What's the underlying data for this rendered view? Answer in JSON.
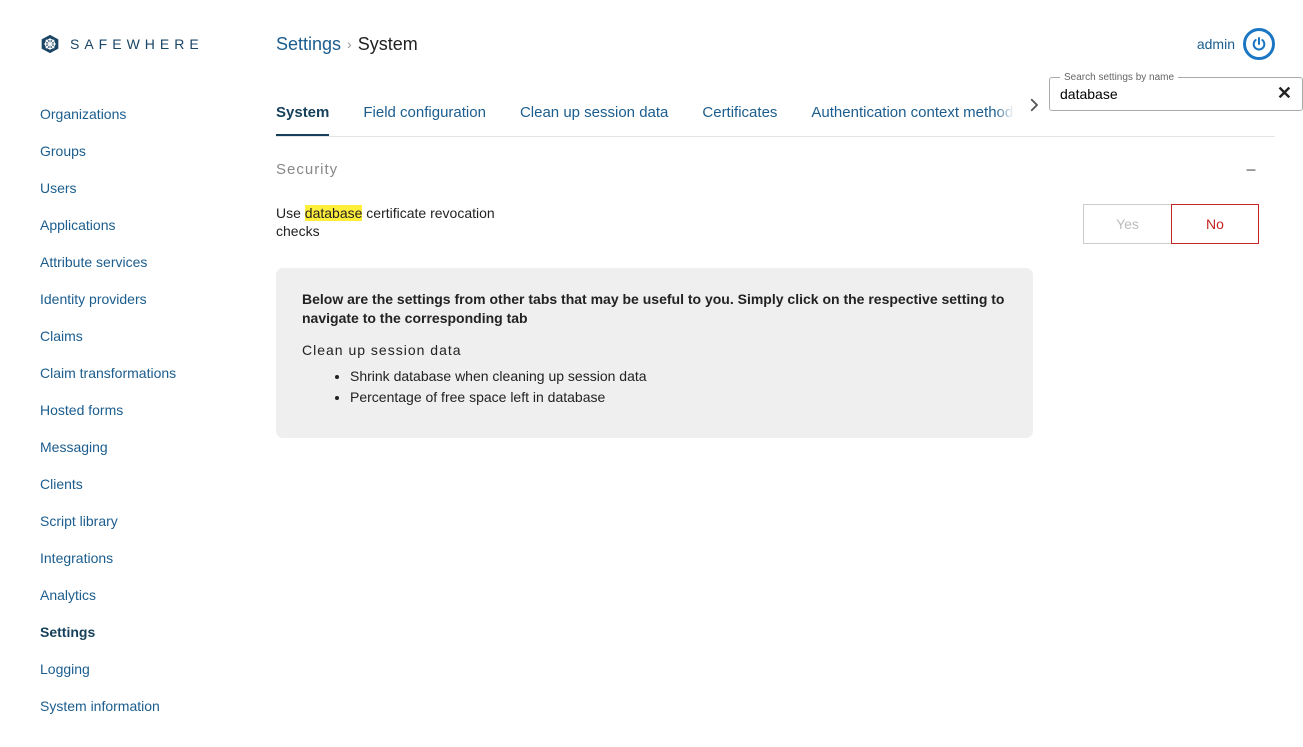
{
  "brand": {
    "name": "SAFEWHERE"
  },
  "header": {
    "breadcrumb_root": "Settings",
    "breadcrumb_leaf": "System",
    "user": "admin"
  },
  "sidebar": {
    "items": [
      "Organizations",
      "Groups",
      "Users",
      "Applications",
      "Attribute services",
      "Identity providers",
      "Claims",
      "Claim transformations",
      "Hosted forms",
      "Messaging",
      "Clients",
      "Script library",
      "Integrations",
      "Analytics",
      "Settings",
      "Logging",
      "System information"
    ],
    "active": "Settings"
  },
  "tabs": {
    "items": [
      "System",
      "Field configuration",
      "Clean up session data",
      "Certificates",
      "Authentication context method"
    ],
    "active": "System"
  },
  "search": {
    "label": "Search settings by name",
    "value": "database"
  },
  "section": {
    "title": "Security",
    "setting": {
      "label_pre": "Use ",
      "label_hl": "database",
      "label_post": " certificate revocation checks",
      "yes": "Yes",
      "no": "No",
      "value": "No"
    }
  },
  "suggestions": {
    "intro": "Below are the settings from other tabs that may be useful to you. Simply click on the respective setting to navigate to the corresponding tab",
    "group_title": "Clean up session data",
    "items": [
      "Shrink database when cleaning up session data",
      "Percentage of free space left in database"
    ]
  }
}
